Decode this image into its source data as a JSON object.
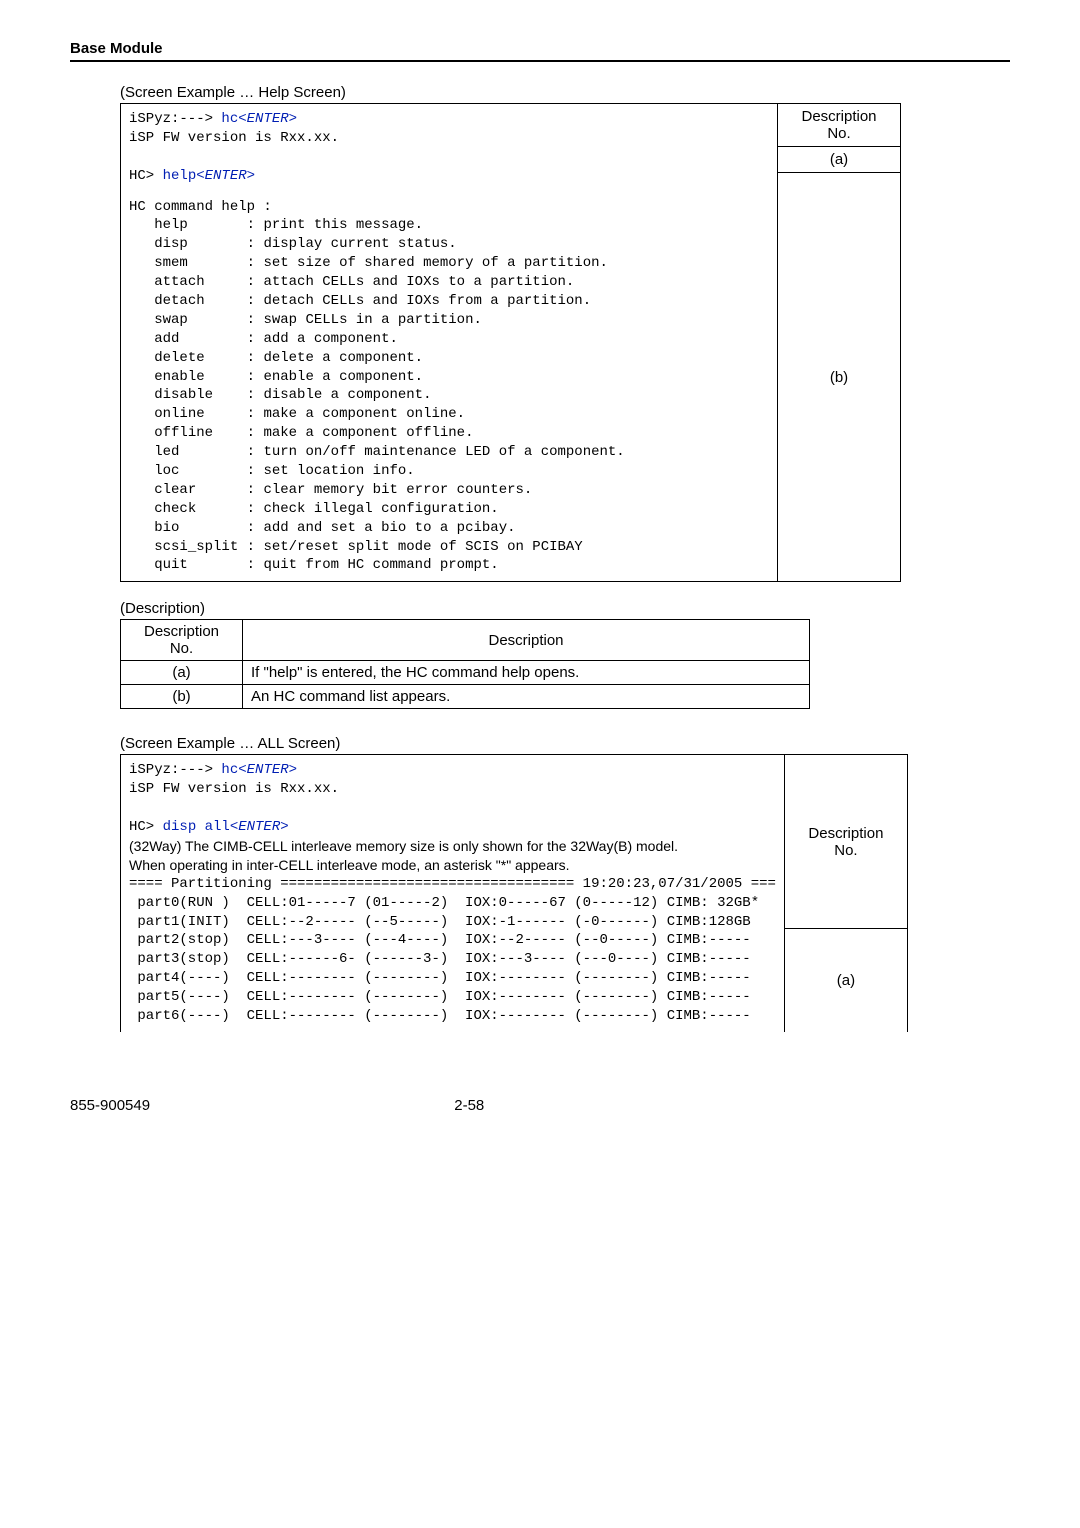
{
  "header": {
    "title": "Base Module"
  },
  "section1": {
    "caption": "(Screen Example … Help Screen)",
    "desc_header": "Description\nNo.",
    "row_a": "(a)",
    "row_b": "(b)",
    "prompt1_pre": "iSPyz:---> ",
    "prompt1_cmd": "hc",
    "prompt1_ent": "<ENTER>",
    "fwline": "iSP FW version is Rxx.xx.",
    "prompt2_pre": "HC> ",
    "prompt2_cmd": "help",
    "prompt2_ent": "<ENTER>",
    "hc_cmd_help": "HC command help :",
    "cmds": [
      [
        "help",
        "print this message."
      ],
      [
        "disp",
        "display current status."
      ],
      [
        "smem",
        "set size of shared memory of a partition."
      ],
      [
        "attach",
        "attach CELLs and IOXs to a partition."
      ],
      [
        "detach",
        "detach CELLs and IOXs from a partition."
      ],
      [
        "swap",
        "swap CELLs in a partition."
      ],
      [
        "add",
        "add a component."
      ],
      [
        "delete",
        "delete a component."
      ],
      [
        "enable",
        "enable a component."
      ],
      [
        "disable",
        "disable a component."
      ],
      [
        "online",
        "make a component online."
      ],
      [
        "offline",
        "make a component offline."
      ],
      [
        "led",
        "turn on/off maintenance LED of a component."
      ],
      [
        "loc",
        "set location info."
      ],
      [
        "clear",
        "clear memory bit error counters."
      ],
      [
        "check",
        "check illegal configuration."
      ],
      [
        "bio",
        "add and set a bio to a pcibay."
      ],
      [
        "scsi_split",
        "set/reset split mode of SCIS on PCIBAY"
      ],
      [
        "quit",
        "quit from HC command prompt."
      ]
    ]
  },
  "desc_table1": {
    "caption": "(Description)",
    "head_no": "Description\nNo.",
    "head_desc": "Description",
    "rows": [
      [
        "(a)",
        "If \"help\" is entered, the HC command help opens."
      ],
      [
        "(b)",
        "An HC command list appears."
      ]
    ]
  },
  "section2": {
    "caption": "(Screen Example … ALL Screen)",
    "desc_header": "Description\nNo.",
    "row_a": "(a)",
    "prompt1_pre": "iSPyz:---> ",
    "prompt1_cmd": "hc",
    "prompt1_ent": "<ENTER>",
    "fwline": "iSP FW version is Rxx.xx.",
    "prompt2_pre": "HC> ",
    "prompt2_cmd": "disp all",
    "prompt2_ent": "<ENTER>",
    "note1": "(32Way) The CIMB-CELL interleave memory size is only shown for the 32Way(B) model.",
    "note2": "When operating in inter-CELL interleave mode, an asterisk \"*\" appears.",
    "part_header": "==== Partitioning =================================== 19:20:23,07/31/2005 ===",
    "parts": [
      " part0(RUN )  CELL:01-----7 (01-----2)  IOX:0-----67 (0-----12) CIMB: 32GB*",
      " part1(INIT)  CELL:--2----- (--5-----)  IOX:-1------ (-0------) CIMB:128GB",
      " part2(stop)  CELL:---3---- (---4----)  IOX:--2----- (--0-----) CIMB:-----",
      " part3(stop)  CELL:------6- (------3-)  IOX:---3---- (---0----) CIMB:-----",
      " part4(----)  CELL:-------- (--------)  IOX:-------- (--------) CIMB:-----",
      " part5(----)  CELL:-------- (--------)  IOX:-------- (--------) CIMB:-----",
      " part6(----)  CELL:-------- (--------)  IOX:-------- (--------) CIMB:-----"
    ]
  },
  "footer": {
    "doc_no": "855-900549",
    "page": "2-58"
  }
}
